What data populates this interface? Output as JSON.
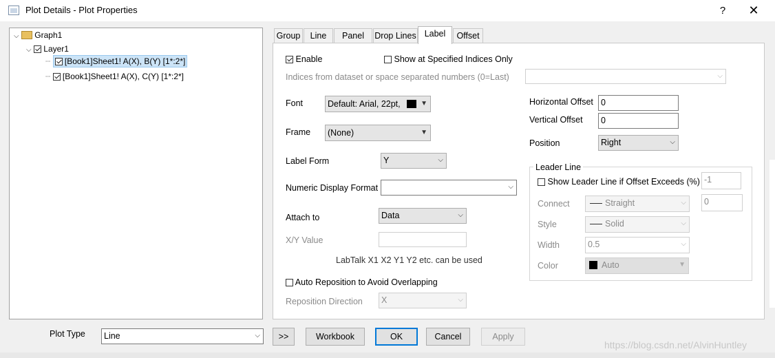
{
  "window": {
    "title": "Plot Details - Plot Properties",
    "help": "?",
    "close": "✕"
  },
  "tree": {
    "graph": "Graph1",
    "layer": "Layer1",
    "plots": [
      "[Book1]Sheet1! A(X), B(Y) [1*:2*]",
      "[Book1]Sheet1! A(X), C(Y) [1*:2*]"
    ]
  },
  "tabs": [
    "Group",
    "Line",
    "Panel",
    "Drop Lines",
    "Label",
    "Offset"
  ],
  "active_tab": "Label",
  "label_tab": {
    "enable": "Enable",
    "show_specified": "Show at Specified Indices Only",
    "indices_hint": "Indices from dataset or space separated numbers (0=Last)",
    "font_label": "Font",
    "font_value": "Default: Arial, 22pt,",
    "frame_label": "Frame",
    "frame_value": "(None)",
    "label_form_label": "Label Form",
    "label_form_value": "Y",
    "numeric_format_label": "Numeric Display Format",
    "numeric_format_value": "",
    "attach_label": "Attach to",
    "attach_value": "Data",
    "xy_value_label": "X/Y Value",
    "labtalk_hint": "LabTalk X1 X2 Y1 Y2 etc. can be used",
    "auto_reposition": "Auto Reposition to Avoid Overlapping",
    "reposition_dir_label": "Reposition Direction",
    "reposition_dir_value": "X",
    "h_offset_label": "Horizontal Offset",
    "h_offset_value": "0",
    "v_offset_label": "Vertical Offset",
    "v_offset_value": "0",
    "position_label": "Position",
    "position_value": "Right",
    "leader": {
      "title": "Leader Line",
      "show_label": "Show Leader Line if Offset Exceeds (%)",
      "exceeds_value": "-1",
      "gap_value": "0",
      "connect_label": "Connect",
      "connect_value": "Straight",
      "style_label": "Style",
      "style_value": "Solid",
      "width_label": "Width",
      "width_value": "0.5",
      "color_label": "Color",
      "color_value": "Auto"
    }
  },
  "bottom": {
    "plot_type_label": "Plot Type",
    "plot_type_value": "Line",
    "more": ">>",
    "workbook": "Workbook",
    "ok": "OK",
    "cancel": "Cancel",
    "apply": "Apply"
  },
  "watermark": "https://blog.csdn.net/AlvinHuntley"
}
